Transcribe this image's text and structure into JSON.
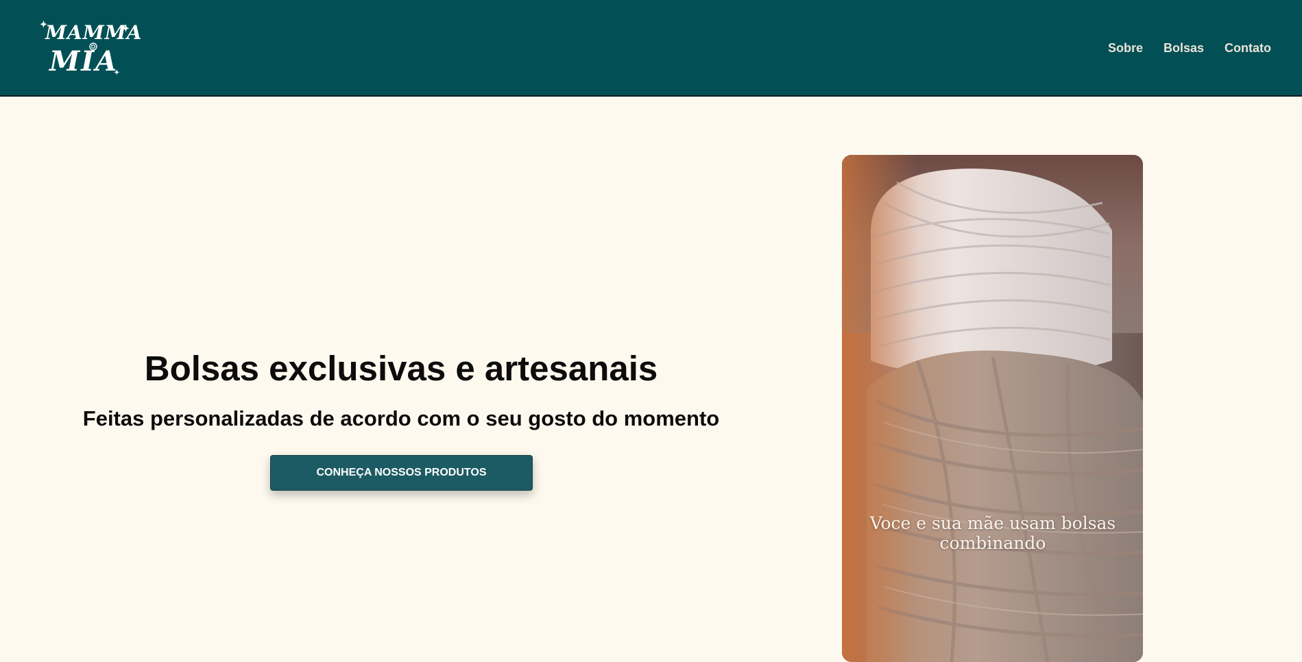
{
  "brand": {
    "logo_line1": "MAMMA",
    "logo_line2": "MIA",
    "colors": {
      "header": "#034f56",
      "page_bg": "#fdf9ee",
      "button": "#1d5b64"
    }
  },
  "nav": {
    "items": [
      {
        "label": "Sobre"
      },
      {
        "label": "Bolsas"
      },
      {
        "label": "Contato"
      }
    ]
  },
  "hero": {
    "title": "Bolsas exclusivas e artesanais",
    "subtitle": "Feitas personalizadas de acordo com o seu gosto do momento",
    "cta_label": "CONHEÇA NOSSOS PRODUTOS"
  },
  "media": {
    "caption": "Voce e sua mãe usam bolsas combinando"
  }
}
